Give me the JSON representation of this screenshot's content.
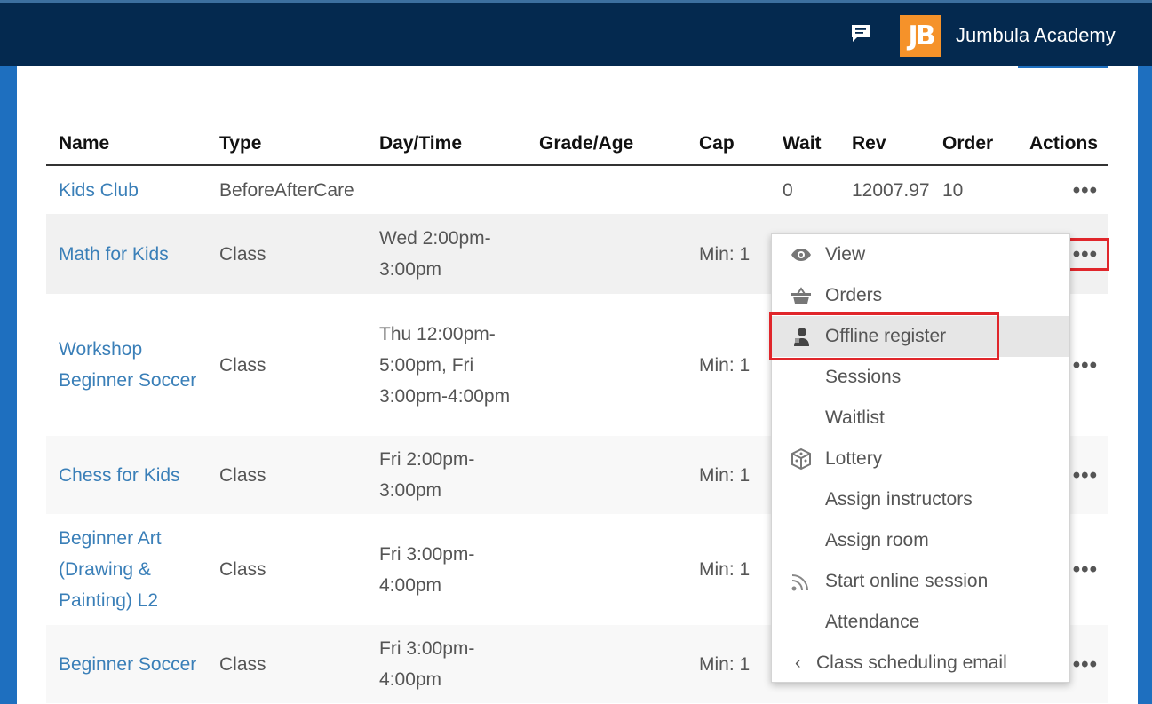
{
  "header": {
    "logo_text": "JB",
    "brand": "Jumbula Academy",
    "icons": {
      "chat": "chat-icon"
    },
    "colors": {
      "topbar": "#04294f",
      "logo": "#f5922a",
      "link": "#3a7fb8",
      "highlight": "#e0262b"
    }
  },
  "table": {
    "columns": [
      "Name",
      "Type",
      "Day/Time",
      "Grade/Age",
      "Cap",
      "Wait",
      "Rev",
      "Order",
      "Actions"
    ],
    "rows": [
      {
        "name": "Kids Club",
        "type": "BeforeAfterCare",
        "daytime": "",
        "grade": "",
        "cap": "",
        "wait": "0",
        "rev": "12007.97",
        "order": "10",
        "actions": "•••"
      },
      {
        "name": "Math for Kids",
        "type": "Class",
        "daytime": "Wed 2:00pm-3:00pm",
        "grade": "",
        "cap": "Min: 1",
        "wait": "",
        "rev": "",
        "order": "",
        "actions": "•••"
      },
      {
        "name": "Workshop Beginner Soccer",
        "type": "Class",
        "daytime": "Thu 12:00pm-5:00pm, Fri 3:00pm-4:00pm",
        "grade": "",
        "cap": "Min: 1",
        "wait": "",
        "rev": "",
        "order": "",
        "actions": "•••"
      },
      {
        "name": "Chess for Kids",
        "type": "Class",
        "daytime": "Fri 2:00pm-3:00pm",
        "grade": "",
        "cap": "Min: 1",
        "wait": "",
        "rev": "",
        "order": "",
        "actions": "•••"
      },
      {
        "name": "Beginner Art (Drawing & Painting) L2",
        "type": "Class",
        "daytime": "Fri 3:00pm-4:00pm",
        "grade": "",
        "cap": "Min: 1",
        "wait": "",
        "rev": "",
        "order": "",
        "actions": "•••"
      },
      {
        "name": "Beginner Soccer",
        "type": "Class",
        "daytime": "Fri 3:00pm-4:00pm",
        "grade": "",
        "cap": "Min: 1",
        "wait": "",
        "rev": "",
        "order": "",
        "actions": "•••"
      }
    ]
  },
  "menu": {
    "items": [
      {
        "label": "View",
        "icon": "eye-icon"
      },
      {
        "label": "Orders",
        "icon": "basket-icon"
      },
      {
        "label": "Offline register",
        "icon": "user-icon",
        "active": true
      },
      {
        "label": "Sessions",
        "icon": ""
      },
      {
        "label": "Waitlist",
        "icon": ""
      },
      {
        "label": "Lottery",
        "icon": "dice-icon"
      },
      {
        "label": "Assign instructors",
        "icon": ""
      },
      {
        "label": "Assign room",
        "icon": ""
      },
      {
        "label": "Start online session",
        "icon": "rss-icon"
      },
      {
        "label": "Attendance",
        "icon": ""
      },
      {
        "label": "Class scheduling email",
        "icon": "chevron-left-icon"
      }
    ]
  }
}
